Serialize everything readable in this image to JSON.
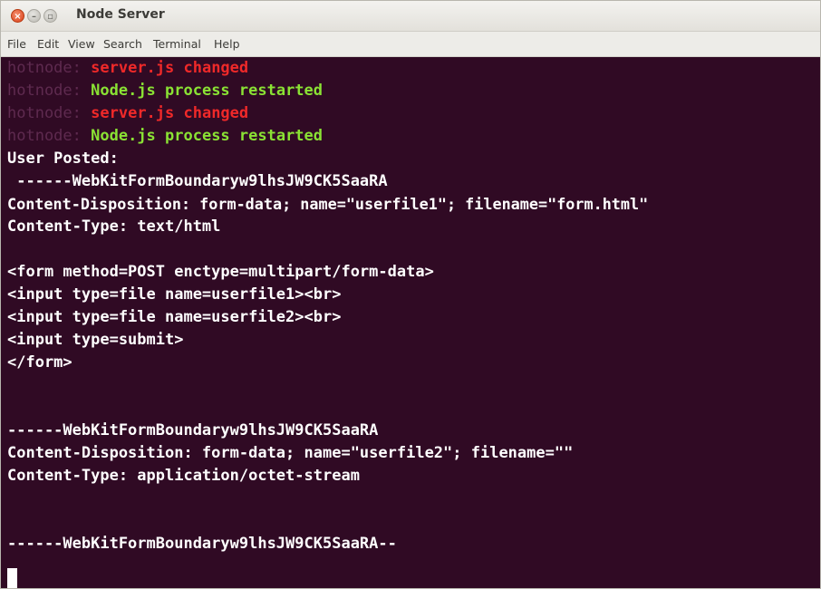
{
  "window": {
    "title": "Node Server"
  },
  "menu": [
    "File",
    "Edit",
    "View",
    "Search",
    "Terminal",
    "Help"
  ],
  "terminal": {
    "log": [
      {
        "prefix": "hotnode:",
        "message": "server.js changed",
        "color": "#ef2929"
      },
      {
        "prefix": "hotnode:",
        "message": "Node.js process restarted",
        "color": "#8ae234"
      },
      {
        "prefix": "hotnode:",
        "message": "server.js changed",
        "color": "#ef2929"
      },
      {
        "prefix": "hotnode:",
        "message": "Node.js process restarted",
        "color": "#8ae234"
      }
    ],
    "output": [
      "User Posted:",
      " ------WebKitFormBoundaryw9lhsJW9CK5SaaRA",
      "Content-Disposition: form-data; name=\"userfile1\"; filename=\"form.html\"",
      "Content-Type: text/html",
      "",
      "<form method=POST enctype=multipart/form-data>",
      "<input type=file name=userfile1><br>",
      "<input type=file name=userfile2><br>",
      "<input type=submit>",
      "</form>",
      "",
      "",
      "------WebKitFormBoundaryw9lhsJW9CK5SaaRA",
      "Content-Disposition: form-data; name=\"userfile2\"; filename=\"\"",
      "Content-Type: application/octet-stream",
      "",
      "",
      "------WebKitFormBoundaryw9lhsJW9CK5SaaRA--"
    ]
  },
  "colors": {
    "terminal_background": "#300a24",
    "prefix": "#5e2a4f",
    "changed": "#ef2929",
    "restarted": "#8ae234",
    "text": "#ffffff"
  },
  "icons": {
    "close": "close-icon",
    "minimize": "minimize-icon",
    "maximize": "maximize-icon"
  }
}
